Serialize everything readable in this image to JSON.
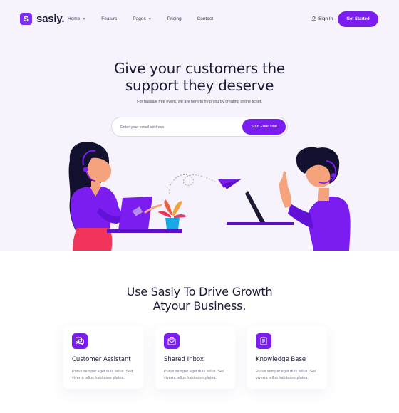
{
  "brand": {
    "name": "sasly.",
    "mark": "$"
  },
  "nav": {
    "items": [
      {
        "label": "Home",
        "caret": true
      },
      {
        "label": "Featurs",
        "caret": false
      },
      {
        "label": "Pages",
        "caret": true
      },
      {
        "label": "Pricing",
        "caret": false
      },
      {
        "label": "Contact",
        "caret": false
      }
    ],
    "sign_in": "Sign In",
    "get_started": "Get Started"
  },
  "hero": {
    "title_line1": "Give your customers the",
    "title_line2": "support they deserve",
    "subtitle": "For hassale free event, we are here to help you by creating online ticket.",
    "email_placeholder": "Enter your email address",
    "cta": "Start Free Trial"
  },
  "features": {
    "title_line1": "Use Sasly To Drive Growth",
    "title_line2": "Atyour Business.",
    "cards": [
      {
        "title": "Customer Assistant",
        "text": "Purus semper eget duis tellus. Sed viverra tellus habitasse platea.",
        "icon": "chat-bubbles-icon"
      },
      {
        "title": "Shared Inbox",
        "text": "Purus semper eget duis tellus. Sed viverra tellus habitasse platea.",
        "icon": "inbox-envelope-icon"
      },
      {
        "title": "Knowledge Base",
        "text": "Purus semper eget duis tellus. Sed viverra tellus habitasse platea.",
        "icon": "document-icon"
      }
    ]
  },
  "colors": {
    "accent": "#7b1cf0",
    "hero_bg": "#f6f3fc",
    "text_dark": "#1b1934",
    "skirt": "#f2345a"
  }
}
